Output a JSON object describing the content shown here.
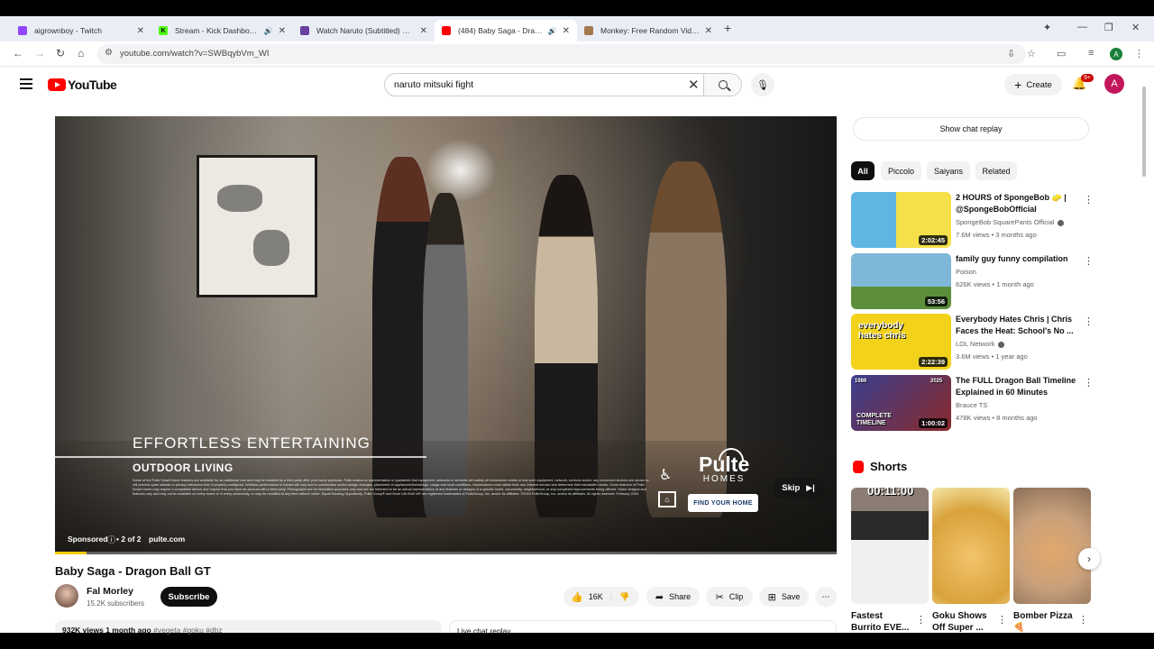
{
  "browser": {
    "tabs": [
      {
        "title": "aigrownboy - Twitch",
        "color": "#9146ff",
        "audio": false,
        "active": false
      },
      {
        "title": "Stream - Kick Dashboard",
        "color": "#53fc18",
        "audio": true,
        "active": false
      },
      {
        "title": "Watch Naruto (Subtitled) S01:E",
        "color": "#6b3fa0",
        "audio": false,
        "active": false
      },
      {
        "title": "(484) Baby Saga - Dragon B",
        "color": "#ff0000",
        "audio": true,
        "active": true
      },
      {
        "title": "Monkey: Free Random Video C",
        "color": "#a6784e",
        "audio": false,
        "active": false
      }
    ],
    "url": "youtube.com/watch?v=SWBqybVm_WI",
    "profile_initial": "A"
  },
  "youtube": {
    "logo_text": "YouTube",
    "search_query": "naruto mitsuki fight",
    "create_label": "Create",
    "notification_count": "9+",
    "account_initial": "A"
  },
  "player": {
    "ad": {
      "headline": "EFFORTLESS ENTERTAINING",
      "subhead": "OUTDOOR LIVING",
      "fine_print": "Some of the Pulte Smart Home features are available for an additional cost and may be installed by a third party after your home purchase. Pulte makes no representation or guarantee that equipment, networks or services will satisfy all homeowner needs or that such equipment, network, services and/or any connected devices are secure or will prevent cyber attacks or privacy intrusions even if properly configured. Wireless performance in homes will vary due to construction and/or design changes, placement of appliances/furnishings, usage and local conditions. Homeowners must obtain their own internet service and determine their bandwidth needs. Some features of Pulte Smart Home may require a compatible device and require that you have an account with a third party. Photographs are for illustrative purposes only and are not intended to be an actual representation of any features or designs of a specific home, community, neighborhood, or any completed improvements being offered. Home designs and features vary and may not be available on every home or in every community, or may be modified at any time without notice. Equal Housing Opportunity. Pulte Group® and More Life Built In® are registered trademarks of PulteGroup, Inc. and/or its affiliates. ©2024 PulteGroup, Inc. and/or its affiliates. All rights reserved. February 2024",
      "brand": "Pulte",
      "brand_sub": "HOMES",
      "cta": "FIND YOUR HOME",
      "skip_label": "Skip",
      "sponsored_label": "Sponsored",
      "ad_count": "• 2 of 2",
      "domain": "pulte.com",
      "progress": 0.04,
      "progress_color": "#ffcc00"
    }
  },
  "video": {
    "title": "Baby Saga - Dragon Ball GT",
    "channel": "Fal Morley",
    "subscribers": "15.2K subscribers",
    "subscribe_label": "Subscribe",
    "likes": "16K",
    "share_label": "Share",
    "clip_label": "Clip",
    "save_label": "Save",
    "views_date": "932K views  1 month ago",
    "tags": "#vegeta #goku #dbz",
    "live_chat_label": "Live chat replay"
  },
  "sidebar": {
    "show_chat_replay": "Show chat replay",
    "chips": [
      "All",
      "Piccolo",
      "Saiyans",
      "Related"
    ],
    "selected_chip": "All",
    "recommendations": [
      {
        "title": "2 HOURS of SpongeBob 🧽 | @SpongeBobOfficial",
        "channel": "SpongeBob SquarePants Official",
        "verified": true,
        "meta": "7.6M views • 3 months ago",
        "duration": "2:02:45",
        "thumb_bg": "#5fb6e3"
      },
      {
        "title": "family  guy funny compilation",
        "channel": "Poison",
        "verified": false,
        "meta": "626K views • 1 month ago",
        "duration": "53:56",
        "thumb_bg": "#7fb7d8"
      },
      {
        "title": "Everybody Hates Chris | Chris Faces the Heat: School's No ...",
        "channel": "LOL Network",
        "verified": true,
        "meta": "3.6M views • 1 year ago",
        "duration": "2:22:39",
        "thumb_bg": "#f2d21b",
        "thumb_text": "everybody hates chris"
      },
      {
        "title": "The FULL Dragon Ball Timeline Explained in 60 Minutes",
        "channel": "Brauce TS",
        "verified": false,
        "meta": "478K views • 8 months ago",
        "duration": "1:00:02",
        "thumb_bg": "#3b3f8f",
        "thumb_text": "COMPLETE TIMELINE",
        "thumb_years": [
          "1986",
          "2025"
        ]
      }
    ],
    "shorts_label": "Shorts",
    "shorts": [
      {
        "title": "Fastest Burrito EVE...",
        "overlay": "00:11:00",
        "bg": "#8b7d73"
      },
      {
        "title": "Goku Shows Off Super ...",
        "bg": "#f2c46b"
      },
      {
        "title": "Bomber Pizza🍕",
        "bg": "#c9a07b"
      }
    ]
  }
}
